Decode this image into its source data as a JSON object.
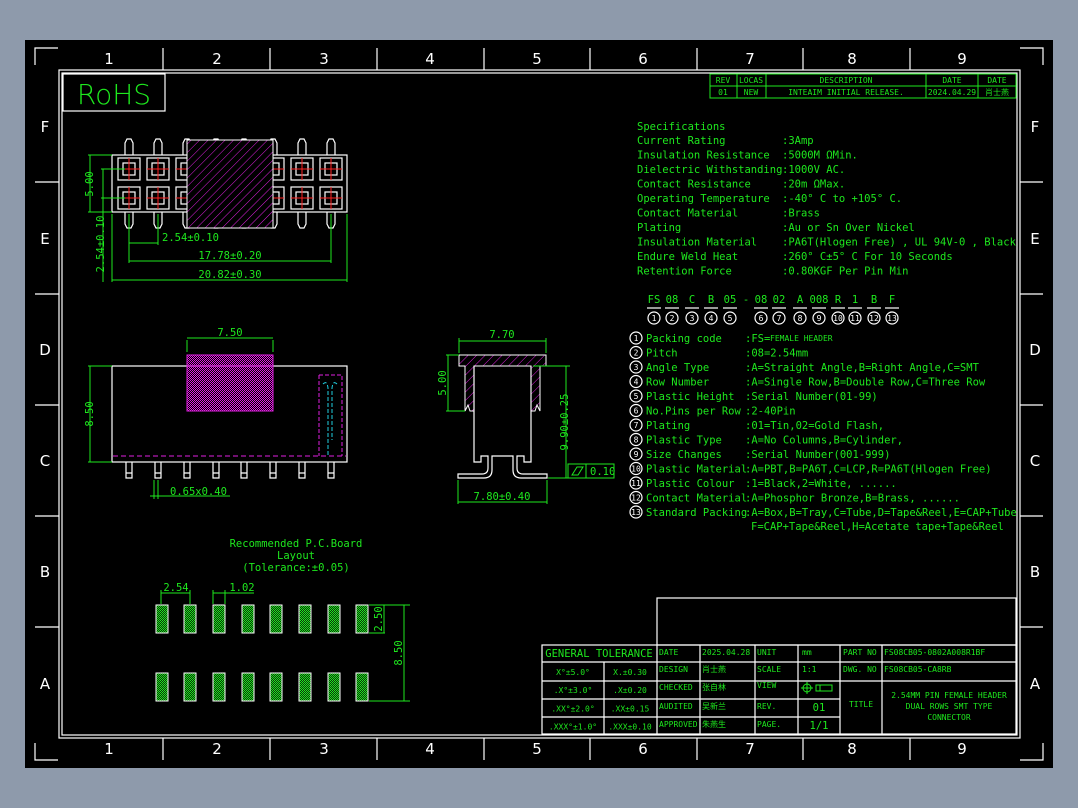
{
  "colors": {
    "background": "#000000",
    "text": "#1ee81e",
    "outline": "#ffffff",
    "hatch": "#e020e0",
    "centerline": "#ff2020",
    "viewport": "#8e9aab"
  },
  "frame": {
    "columns": [
      "1",
      "2",
      "3",
      "4",
      "5",
      "6",
      "7",
      "8",
      "9"
    ],
    "rows": [
      "F",
      "E",
      "D",
      "C",
      "B",
      "A"
    ]
  },
  "rohs": "RoHS",
  "revision": {
    "headers": [
      "REV",
      "LOCAS",
      "DESCRIPTION",
      "DATE",
      "DATE"
    ],
    "row": [
      "01",
      "NEW",
      "INTEAIM INITIAL RELEASE.",
      "2024.04.29",
      "肖士燕"
    ]
  },
  "specs": {
    "title": "Specifications",
    "items": [
      {
        "label": "Current Rating",
        "value": ":3Amp"
      },
      {
        "label": "Insulation Resistance",
        "value": ":5000M ΩMin."
      },
      {
        "label": "Dielectric Withstanding",
        "value": ":1000V AC."
      },
      {
        "label": "Contact Resistance",
        "value": ":20m ΩMax."
      },
      {
        "label": "Operating Temperature",
        "value": ":-40° C to +105° C."
      },
      {
        "label": "Contact Material",
        "value": ":Brass"
      },
      {
        "label": "Plating",
        "value": ":Au or Sn Over Nickel"
      },
      {
        "label": "Insulation Material",
        "value": ":PA6T(Hlogen Free) , UL 94V-0 , Black"
      },
      {
        "label": "Endure Weld Heat",
        "value": ":260° C±5° C For 10 Seconds"
      },
      {
        "label": "Retention Force",
        "value": ":0.80KGF Per Pin Min"
      }
    ]
  },
  "part_code": {
    "segments": [
      "FS",
      "08",
      "C",
      "B",
      "05",
      "-",
      "08",
      "02",
      "A",
      "008",
      "R",
      "1",
      "B",
      "F"
    ],
    "numbers": [
      "1",
      "2",
      "3",
      "4",
      "5",
      "",
      "6",
      "7",
      "8",
      "9",
      "10",
      "11",
      "12",
      "13"
    ]
  },
  "legend": [
    {
      "n": "1",
      "label": "Packing code",
      "value": ":FS=",
      "note": "FEMALE HEADER"
    },
    {
      "n": "2",
      "label": "Pitch",
      "value": ":08=2.54mm"
    },
    {
      "n": "3",
      "label": "Angle Type",
      "value": ":A=Straight Angle,B=Right Angle,C=SMT"
    },
    {
      "n": "4",
      "label": "Row Number",
      "value": ":A=Single Row,B=Double Row,C=Three Row"
    },
    {
      "n": "5",
      "label": "Plastic Height",
      "value": ":Serial Number(01-99)"
    },
    {
      "n": "6",
      "label": "No.Pins per Row",
      "value": ":2-40Pin"
    },
    {
      "n": "7",
      "label": "Plating",
      "value": ":01=Tin,02=Gold Flash,"
    },
    {
      "n": "8",
      "label": "Plastic Type",
      "value": ":A=No Columns,B=Cylinder,"
    },
    {
      "n": "9",
      "label": "Size Changes",
      "value": ":Serial Number(001-999)"
    },
    {
      "n": "10",
      "label": "Plastic Material",
      "value": ":A=PBT,B=PA6T,C=LCP,R=PA6T(Hlogen Free)"
    },
    {
      "n": "11",
      "label": "Plastic Colour",
      "value": ":1=Black,2=White, ......"
    },
    {
      "n": "12",
      "label": "Contact Material",
      "value": ":A=Phosphor Bronze,B=Brass, ......"
    },
    {
      "n": "13",
      "label": "Standard Packing",
      "value": ":A=Box,B=Tray,C=Tube,D=Tape&Reel,E=CAP+Tube"
    }
  ],
  "legend_cont": "F=CAP+Tape&Reel,H=Acetate tape+Tape&Reel",
  "dims": {
    "pitch": "2.54±0.10",
    "span": "17.78±0.20",
    "length": "20.82±0.30",
    "height_top": "5.00",
    "row_pitch": "2.54±0.10",
    "cap_width": "7.50",
    "side_height": "8.50",
    "pin_size": "0.65x0.40",
    "front_width": "7.70",
    "front_cap": "5.00",
    "front_height": "9.90±0.25",
    "foot_span": "7.80±0.40",
    "flatness": "0.10"
  },
  "pcb": {
    "title": "Recommended P.C.Board",
    "subtitle": "Layout",
    "tolerance": "(Tolerance:±0.05)",
    "pitch": "2.54",
    "pad_width": "1.02",
    "pad_length": "2.50",
    "row_span": "8.50"
  },
  "title_block": {
    "general_tolerance": "GENERAL TOLERANCE",
    "tol": [
      [
        "X°±5.0°",
        "X.±0.30"
      ],
      [
        ".X°±3.0°",
        ".X±0.20"
      ],
      [
        ".XX°±2.0°",
        ".XX±0.15"
      ],
      [
        ".XXX°±1.0°",
        ".XXX±0.10"
      ]
    ],
    "date_label": "DATE",
    "date": "2025.04.28",
    "unit_label": "UNIT",
    "unit": "mm",
    "design_label": "DESIGN",
    "design": "肖士燕",
    "scale_label": "SCALE",
    "scale": "1:1",
    "checked_label": "CHECKED",
    "checked": "张自林",
    "view_label": "VIEW",
    "audited_label": "AUDITED",
    "audited": "吴新兰",
    "rev_label": "REV.",
    "rev": "01",
    "approved_label": "APPROVED",
    "approved": "朱燕生",
    "page_label": "PAGE.",
    "page": "1/1",
    "part_no_label": "PART NO",
    "part_no": "FS08CB05-0802A008R1BF",
    "dwg_no_label": "DWG. NO",
    "dwg_no": "FS08CB05-CA8RB",
    "title_label": "TITLE",
    "title": [
      "2.54MM PIN FEMALE HEADER",
      "DUAL ROWS SMT TYPE",
      "CONNECTOR"
    ]
  }
}
